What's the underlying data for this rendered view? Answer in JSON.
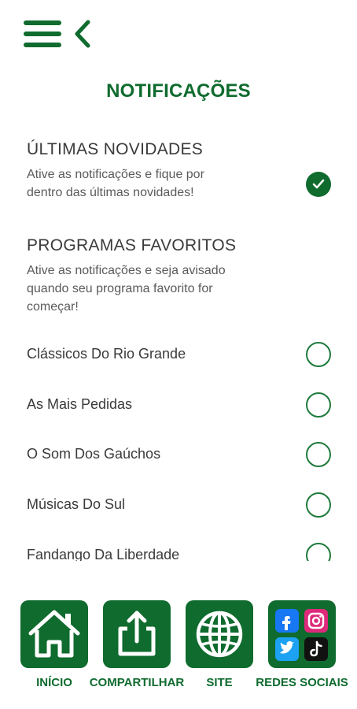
{
  "page": {
    "title": "NOTIFICAÇÕES"
  },
  "sections": {
    "latest": {
      "title": "ÚLTIMAS NOVIDADES",
      "desc_line1": "Ative as notificações e fique por",
      "desc_line2": "dentro das últimas novidades!",
      "enabled": true
    },
    "favorites": {
      "title": "PROGRAMAS FAVORITOS",
      "desc_line1": "Ative as notificações e seja avisado",
      "desc_line2": "quando seu programa favorito for",
      "desc_line3": "começar!"
    }
  },
  "programs": [
    {
      "name": "Clássicos Do Rio Grande",
      "enabled": false
    },
    {
      "name": "As Mais Pedidas",
      "enabled": false
    },
    {
      "name": "O Som Dos Gaúchos",
      "enabled": false
    },
    {
      "name": "Músicas Do Sul",
      "enabled": false
    },
    {
      "name": "Fandango Da Liberdade",
      "enabled": false
    }
  ],
  "bottom_nav": [
    {
      "label": "INÍCIO",
      "icon": "home-icon"
    },
    {
      "label": "COMPARTILHAR",
      "icon": "share-icon"
    },
    {
      "label": "SITE",
      "icon": "globe-icon"
    },
    {
      "label": "REDES SOCIAIS",
      "icon": "social-networks-icon"
    }
  ],
  "colors": {
    "brand_green": "#0f6b2e",
    "text": "#3a3a3a",
    "facebook": "#1877f2",
    "twitter": "#1da1f2",
    "instagram": "#dd2a7b",
    "tiktok": "#111111"
  }
}
